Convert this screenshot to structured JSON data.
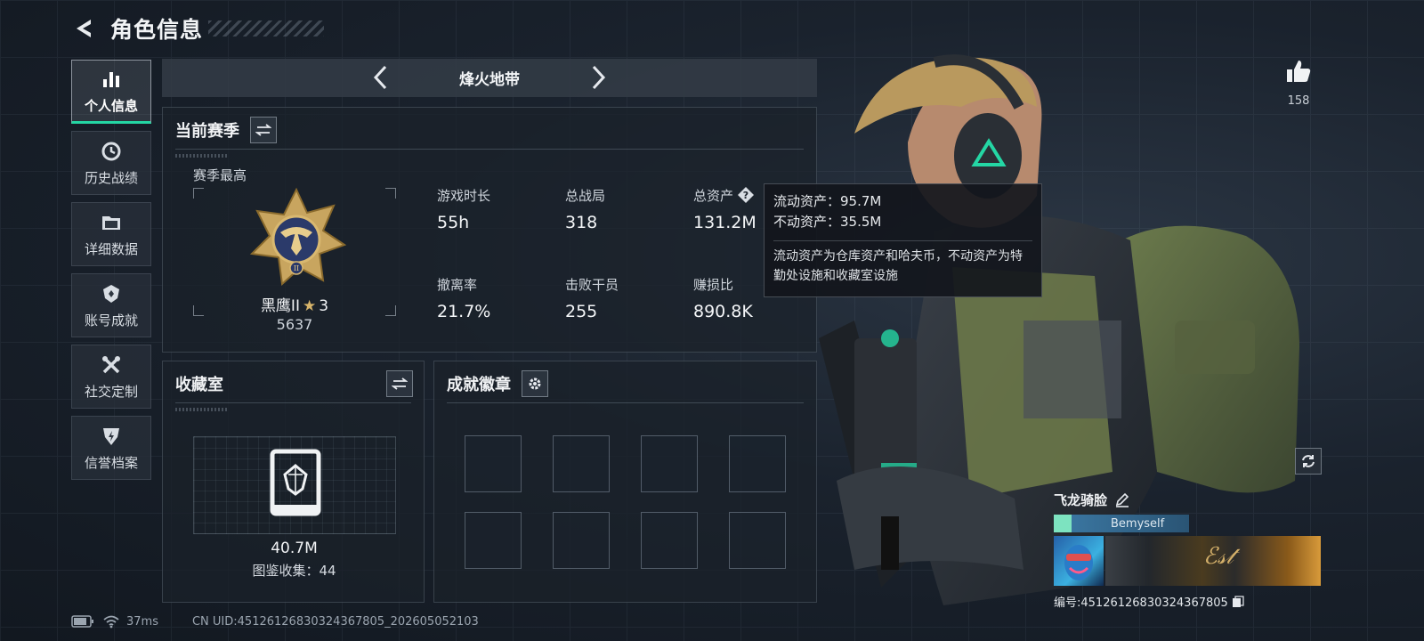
{
  "header": {
    "title": "角色信息"
  },
  "sidebar": {
    "items": [
      {
        "label": "个人信息",
        "icon": "bar-chart-icon",
        "active": true
      },
      {
        "label": "历史战绩",
        "icon": "clock-icon"
      },
      {
        "label": "详细数据",
        "icon": "folder-icon"
      },
      {
        "label": "账号成就",
        "icon": "achievement-icon"
      },
      {
        "label": "社交定制",
        "icon": "tools-icon"
      },
      {
        "label": "信誉档案",
        "icon": "shield-icon"
      }
    ]
  },
  "mode": {
    "title": "烽火地带"
  },
  "season": {
    "title": "当前赛季",
    "best_label": "赛季最高",
    "rank_name": "黑鹰II",
    "rank_stars": "3",
    "rank_score": "5637",
    "stats": [
      {
        "label": "游戏时长",
        "value": "55h"
      },
      {
        "label": "总战局",
        "value": "318"
      },
      {
        "label": "总资产",
        "value": "131.2M"
      },
      {
        "label": "撤离率",
        "value": "21.7%"
      },
      {
        "label": "击败干员",
        "value": "255"
      },
      {
        "label": "赚损比",
        "value": "890.8K"
      }
    ]
  },
  "tooltip": {
    "liquid": "流动资产：95.7M",
    "fixed": "不动资产：35.5M",
    "note": "流动资产为仓库资产和哈夫币，不动资产为特勤处设施和收藏室设施"
  },
  "collection": {
    "title": "收藏室",
    "value": "40.7M",
    "count_text": "图鉴收集：44"
  },
  "achievements": {
    "title": "成就徽章",
    "slot_count": 8
  },
  "likes": {
    "count": "158"
  },
  "profile": {
    "nickname": "飞龙骑脸",
    "title_tag": "Bemyself",
    "uid_text": "编号:451261268303243678​05"
  },
  "footer": {
    "ping": "37ms",
    "uid_line": "CN UID:451261268303243678​05_202605052103"
  },
  "colors": {
    "accent": "#24d6a4",
    "rank_gold": "#d7b46a",
    "background": "#141b24"
  }
}
